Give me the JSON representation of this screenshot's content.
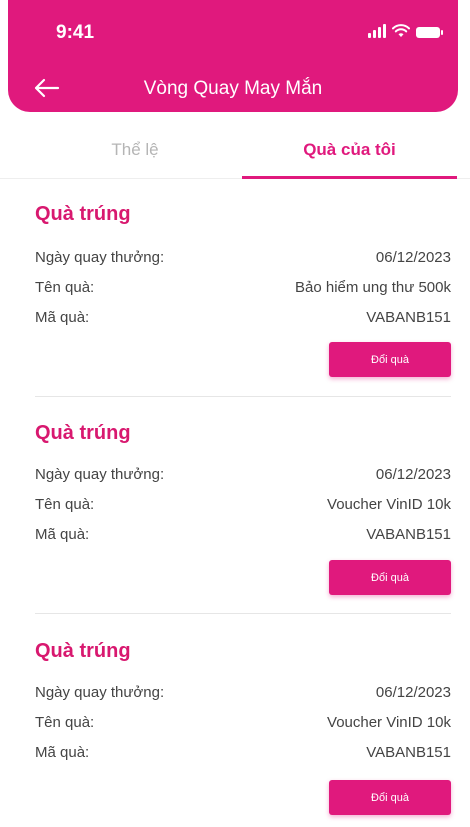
{
  "status_bar": {
    "time": "9:41"
  },
  "header": {
    "title": "Vòng Quay May Mắn"
  },
  "tabs": [
    {
      "label": "Thể lệ",
      "active": false
    },
    {
      "label": "Quà của tôi",
      "active": true
    }
  ],
  "prizes": [
    {
      "title": "Quà trúng",
      "date_label": "Ngày quay thưởng:",
      "date_value": "06/12/2023",
      "name_label": "Tên quà:",
      "name_value": "Bảo hiểm ung thư 500k",
      "code_label": "Mã quà:",
      "code_value": "VABANB151",
      "button_label": "Đổi quà"
    },
    {
      "title": "Quà trúng",
      "date_label": "Ngày quay thưởng:",
      "date_value": "06/12/2023",
      "name_label": "Tên quà:",
      "name_value": "Voucher VinID 10k",
      "code_label": "Mã quà:",
      "code_value": "VABANB151",
      "button_label": "Đổi quà"
    },
    {
      "title": "Quà trúng",
      "date_label": "Ngày quay thưởng:",
      "date_value": "06/12/2023",
      "name_label": "Tên quà:",
      "name_value": "Voucher VinID 10k",
      "code_label": "Mã quà:",
      "code_value": "VABANB151",
      "button_label": "Đổi quà"
    }
  ],
  "colors": {
    "brand": "#e0197d",
    "title_pink": "#d8186f",
    "inactive_tab": "#b5b5b5"
  },
  "icons": {
    "back": "arrow-left-icon",
    "signal": "signal-icon",
    "wifi": "wifi-icon",
    "battery": "battery-icon"
  }
}
